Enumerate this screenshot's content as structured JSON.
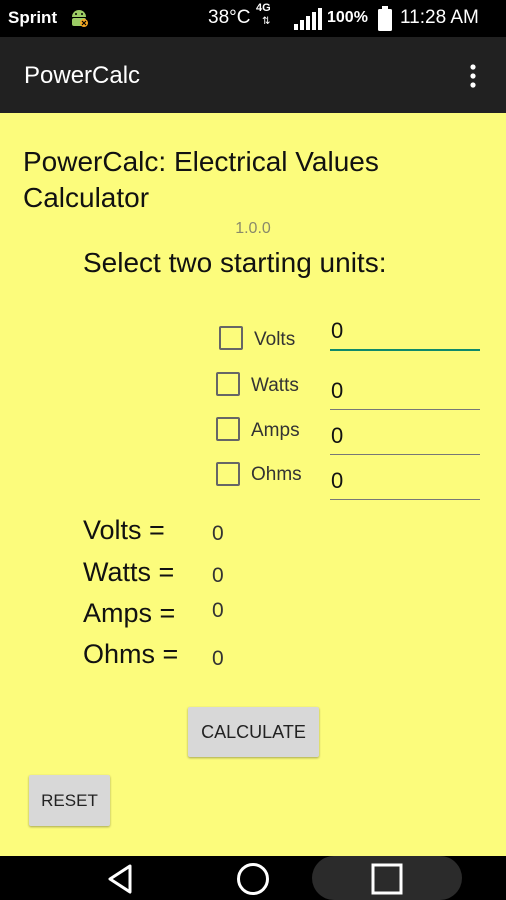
{
  "status_bar": {
    "carrier": "Sprint",
    "temperature": "38°C",
    "network": "4G",
    "battery": "100%",
    "time": "11:28 AM"
  },
  "app_bar": {
    "title": "PowerCalc",
    "menu_icon": "more-vert-icon"
  },
  "main": {
    "heading": "PowerCalc: Electrical Values Calculator",
    "version": "1.0.0",
    "instruction": "Select two starting units:",
    "units": [
      {
        "label": "Volts",
        "value": "0",
        "checked": false
      },
      {
        "label": "Watts",
        "value": "0",
        "checked": false
      },
      {
        "label": "Amps",
        "value": "0",
        "checked": false
      },
      {
        "label": "Ohms",
        "value": "0",
        "checked": false
      }
    ],
    "results": [
      {
        "label": "Volts =",
        "value": "0"
      },
      {
        "label": "Watts =",
        "value": "0"
      },
      {
        "label": "Amps =",
        "value": "0"
      },
      {
        "label": "Ohms =",
        "value": "0"
      }
    ],
    "calculate_label": "CALCULATE",
    "reset_label": "RESET"
  },
  "colors": {
    "background": "#fcfc7c",
    "app_bar": "#212121",
    "focus_accent": "#0f8a6a"
  }
}
